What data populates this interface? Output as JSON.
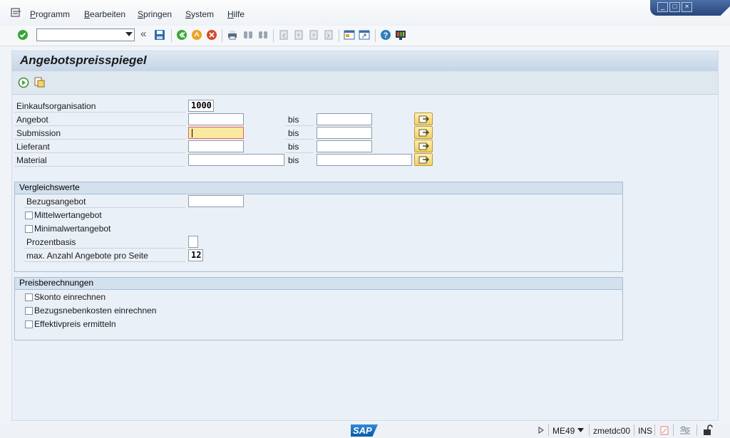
{
  "menu": [
    {
      "first": "P",
      "rest": "rogramm"
    },
    {
      "first": "B",
      "rest": "earbeiten"
    },
    {
      "first": "S",
      "rest": "pringen"
    },
    {
      "first": "S",
      "rest": "ystem"
    },
    {
      "first": "H",
      "rest": "ilfe"
    }
  ],
  "page_title": "Angebotspreisspiegel",
  "selection": {
    "einkaufsorg_label": "Einkaufsorganisation",
    "einkaufsorg_value": "1000",
    "angebot_label": "Angebot",
    "submission_label": "Submission",
    "lieferant_label": "Lieferant",
    "material_label": "Material",
    "bis_label": "bis"
  },
  "vergleich": {
    "title": "Vergleichswerte",
    "bezugsangebot_label": "Bezugsangebot",
    "mittelwert_label": "Mittelwertangebot",
    "minimalwert_label": "Minimalwertangebot",
    "prozentbasis_label": "Prozentbasis",
    "max_anzahl_label": "max. Anzahl Angebote pro Seite",
    "max_anzahl_value": "12"
  },
  "preis": {
    "title": "Preisberechnungen",
    "skonto_label": "Skonto einrechnen",
    "bezugsneben_label": "Bezugsnebenkosten einrechnen",
    "effektiv_label": "Effektivpreis ermitteln"
  },
  "status": {
    "tcode": "ME49",
    "server": "zmetdc00",
    "mode": "INS",
    "logo": "SAP"
  },
  "colors": {
    "accent_green": "#3aa537",
    "accent_orange": "#f0a020",
    "cancel_red": "#d64a2a",
    "help_blue": "#2f7fc0"
  }
}
